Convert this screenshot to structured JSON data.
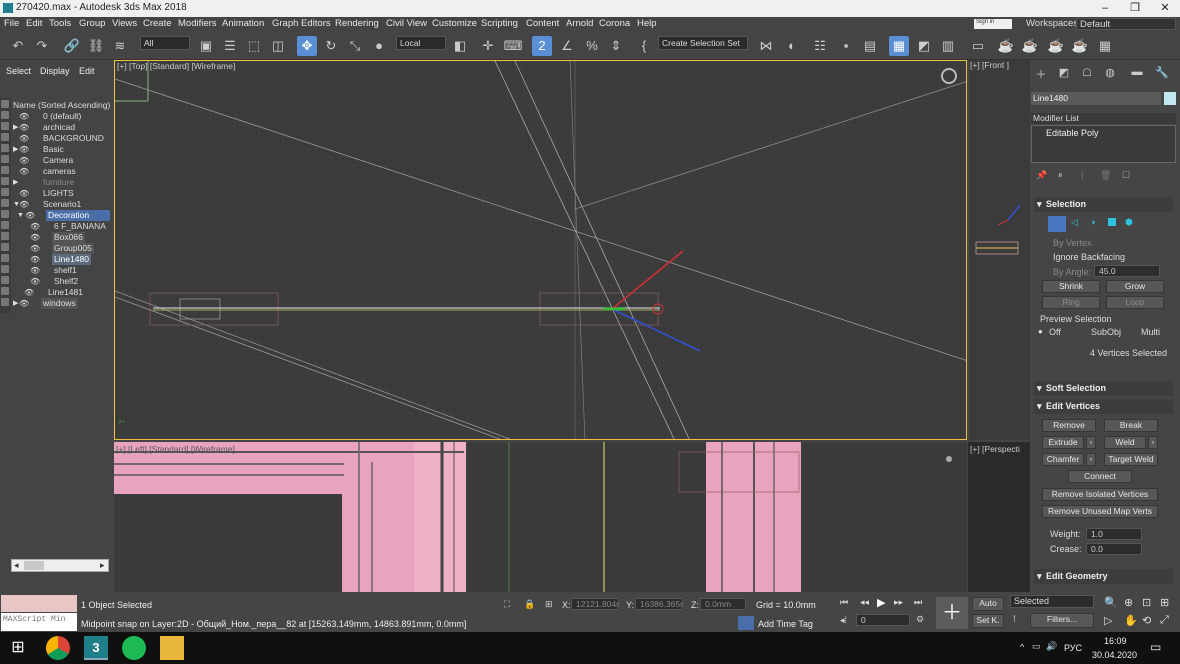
{
  "window": {
    "title": "270420.max - Autodesk 3ds Max 2018",
    "signin": "Sign in",
    "workspaces_label": "Workspaces:",
    "workspace_value": "Default"
  },
  "menu": [
    "File",
    "Edit",
    "Tools",
    "Group",
    "Views",
    "Create",
    "Modifiers",
    "Animation",
    "Graph Editors",
    "Rendering",
    "Civil View",
    "Customize",
    "Scripting",
    "Content",
    "Arnold",
    "Corona",
    "Help"
  ],
  "toolbar": {
    "filter_value": "All",
    "ref_coord": "Local",
    "selection_set": "Create Selection Set",
    "snap_label": "2"
  },
  "scene_explorer": {
    "tabs": [
      "Select",
      "Display",
      "Edit"
    ],
    "column_header": "Name (Sorted Ascending)",
    "items": [
      {
        "name": "0 (default)"
      },
      {
        "name": "archicad"
      },
      {
        "name": "BACKGROUND"
      },
      {
        "name": "Basic"
      },
      {
        "name": "Camera"
      },
      {
        "name": "cameras"
      },
      {
        "name": "furniture"
      },
      {
        "name": "LIGHTS"
      },
      {
        "name": "Scenario1"
      },
      {
        "name": "Decoration"
      },
      {
        "name": "6 F_BANANA"
      },
      {
        "name": "Box066"
      },
      {
        "name": "Group005"
      },
      {
        "name": "Line1480"
      },
      {
        "name": "shelf1"
      },
      {
        "name": "Shelf2"
      },
      {
        "name": "Line1481"
      },
      {
        "name": "windows"
      }
    ]
  },
  "viewports": {
    "top_label": "[+] [Top] [Standard] [Wireframe]",
    "front_label": "[+] [Front ]",
    "bottom_label": "[+] [Left] [Standard] [Wireframe]",
    "persp_label": "[+] [Perspecti"
  },
  "command_panel": {
    "object_name": "Line1480",
    "object_color": "#bfe8f0",
    "modifier_list": "Modifier List",
    "stack_item": "Editable Poly",
    "selection": {
      "title": "Selection",
      "by_vertex": "By Vertex",
      "ignore_backfacing": "Ignore Backfacing",
      "by_angle": "By Angle:",
      "angle_value": "45.0",
      "shrink": "Shrink",
      "grow": "Grow",
      "ring": "Ring",
      "loop": "Loop",
      "preview": "Preview Selection",
      "off": "Off",
      "subobj": "SubObj",
      "multi": "Multi",
      "status": "4 Vertices Selected"
    },
    "soft_selection": "Soft Selection",
    "edit_vertices": {
      "title": "Edit Vertices",
      "remove": "Remove",
      "break": "Break",
      "extrude": "Extrude",
      "weld": "Weld",
      "chamfer": "Chamfer",
      "target_weld": "Target Weld",
      "connect": "Connect",
      "remove_isolated": "Remove Isolated Vertices",
      "remove_unused": "Remove Unused Map Verts",
      "weight_label": "Weight:",
      "weight_value": "1.0",
      "crease_label": "Crease:",
      "crease_value": "0.0"
    },
    "edit_geometry": "Edit Geometry"
  },
  "status": {
    "maxscript": "MAXScript Min",
    "objects_selected": "1 Object Selected",
    "prompt": "Midpoint snap on Layer:2D - Общий_Ном._пера__82 at [15263.149mm, 14863.891mm, 0.0mm]",
    "x_label": "X:",
    "x_value": "12121.804r",
    "y_label": "Y:",
    "y_value": "16386.365r",
    "z_label": "Z:",
    "z_value": "0.0mm",
    "grid": "Grid = 10.0mm",
    "add_time_tag": "Add Time Tag",
    "frame": "0",
    "auto": "Auto",
    "setk": "Set K.",
    "key_mode": "Selected",
    "filters": "Filters..."
  },
  "taskbar": {
    "language": "РУС",
    "time": "16:09",
    "date": "30.04.2020"
  }
}
